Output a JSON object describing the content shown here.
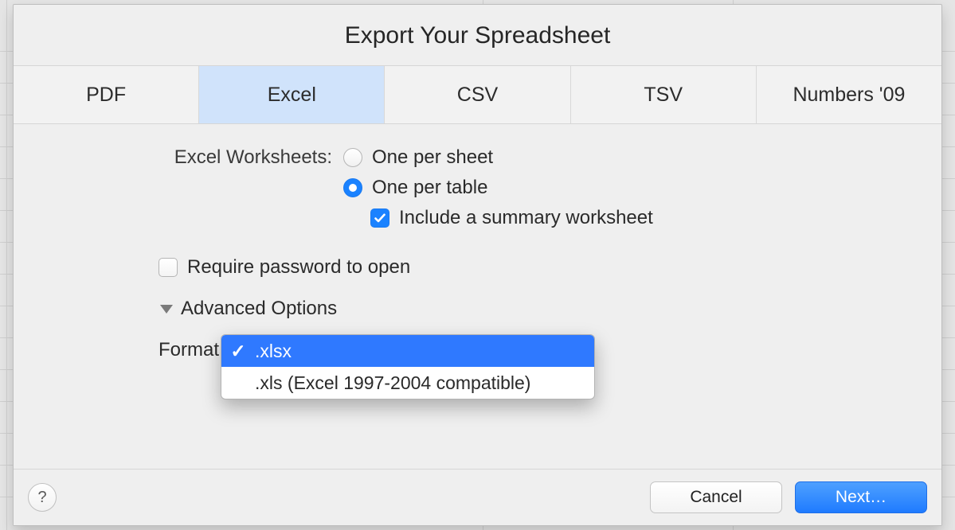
{
  "title": "Export Your Spreadsheet",
  "tabs": [
    "PDF",
    "Excel",
    "CSV",
    "TSV",
    "Numbers '09"
  ],
  "selected_tab_index": 1,
  "worksheets_label": "Excel Worksheets:",
  "radio_options": {
    "one_per_sheet": "One per sheet",
    "one_per_table": "One per table"
  },
  "radio_selected": "one_per_table",
  "include_summary_label": "Include a summary worksheet",
  "include_summary_checked": true,
  "require_password_label": "Require password to open",
  "require_password_checked": false,
  "advanced_label": "Advanced Options",
  "advanced_expanded": true,
  "format_label": "Format",
  "format_options": [
    ".xlsx",
    ".xls (Excel 1997-2004 compatible)"
  ],
  "format_selected_index": 0,
  "help_symbol": "?",
  "buttons": {
    "cancel": "Cancel",
    "next": "Next…"
  }
}
